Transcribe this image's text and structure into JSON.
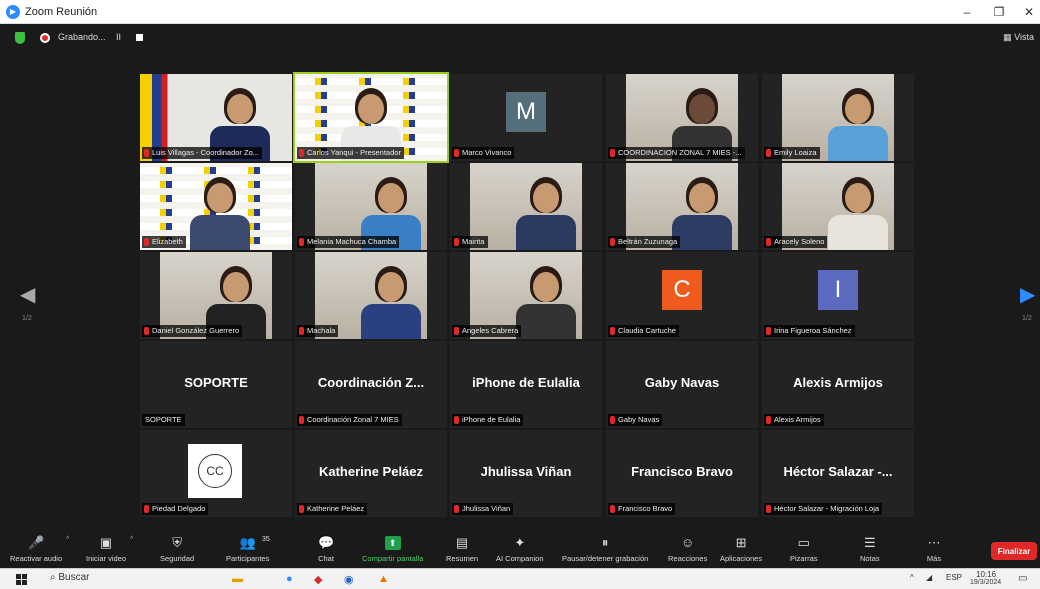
{
  "window": {
    "title": "Zoom Reunión",
    "minimize": "–",
    "maximize": "❐",
    "close": "✕"
  },
  "topbar": {
    "recording": "Grabando...",
    "pause": "II",
    "view": "Vista"
  },
  "pager": {
    "left": "1/2",
    "right": "1/2"
  },
  "tiles": [
    {
      "label": "Luis Villagas - Coordinador Zo..."
    },
    {
      "label": "Carlos Yanqui - Presentador"
    },
    {
      "label": "Marco Vivanco",
      "initial": "M",
      "color": "#546e7a"
    },
    {
      "label": "COORDINACION ZONAL 7 MIES -..."
    },
    {
      "label": "Emily Loaiza"
    },
    {
      "label": "Elizabeth"
    },
    {
      "label": "Melania Machuca Chamba"
    },
    {
      "label": "Mairita"
    },
    {
      "label": "Beltrán Zuzunaga"
    },
    {
      "label": "Aracely Soleno"
    },
    {
      "label": "Daniel González Guerrero"
    },
    {
      "label": "Machala"
    },
    {
      "label": "Angeles Cabrera"
    },
    {
      "label": "Claudia Cartuche",
      "initial": "C",
      "color": "#ef5b1e"
    },
    {
      "label": "Irina Figueroa Sánchez",
      "initial": "I",
      "color": "#5c6bc0"
    },
    {
      "label": "SOPORTE",
      "name": "SOPORTE"
    },
    {
      "label": "Coordinación Zonal 7 MIES",
      "name": "Coordinación Z..."
    },
    {
      "label": "iPhone de Eulalia",
      "name": "iPhone de Eulalia"
    },
    {
      "label": "Gaby Navas",
      "name": "Gaby Navas"
    },
    {
      "label": "Alexis Armijos",
      "name": "Alexis Armijos"
    },
    {
      "label": "Piedad Delgado",
      "logo": "CC"
    },
    {
      "label": "Katherine Peláez",
      "name": "Katherine Peláez"
    },
    {
      "label": "Jhulissa Viñan",
      "name": "Jhulissa Viñan"
    },
    {
      "label": "Francisco Bravo",
      "name": "Francisco Bravo"
    },
    {
      "label": "Héctor Salazar - Migración Loja",
      "name": "Héctor Salazar -..."
    }
  ],
  "toolbar": {
    "audio": "Reactivar audio",
    "video": "Iniciar video",
    "security": "Seguridad",
    "participants": "Participantes",
    "participants_count": "35",
    "chat": "Chat",
    "share": "Compartir pantalla",
    "summary": "Resumen",
    "companion": "AI Companion",
    "recording": "Pausar/detener grabación",
    "reactions": "Reacciones",
    "apps": "Aplicaciones",
    "whiteboards": "Pizarras",
    "notes": "Notas",
    "more": "Más",
    "end": "Finalizar"
  },
  "taskbar": {
    "search": "Buscar",
    "lang": "ESP",
    "time": "10:16",
    "date": "19/3/2024"
  }
}
